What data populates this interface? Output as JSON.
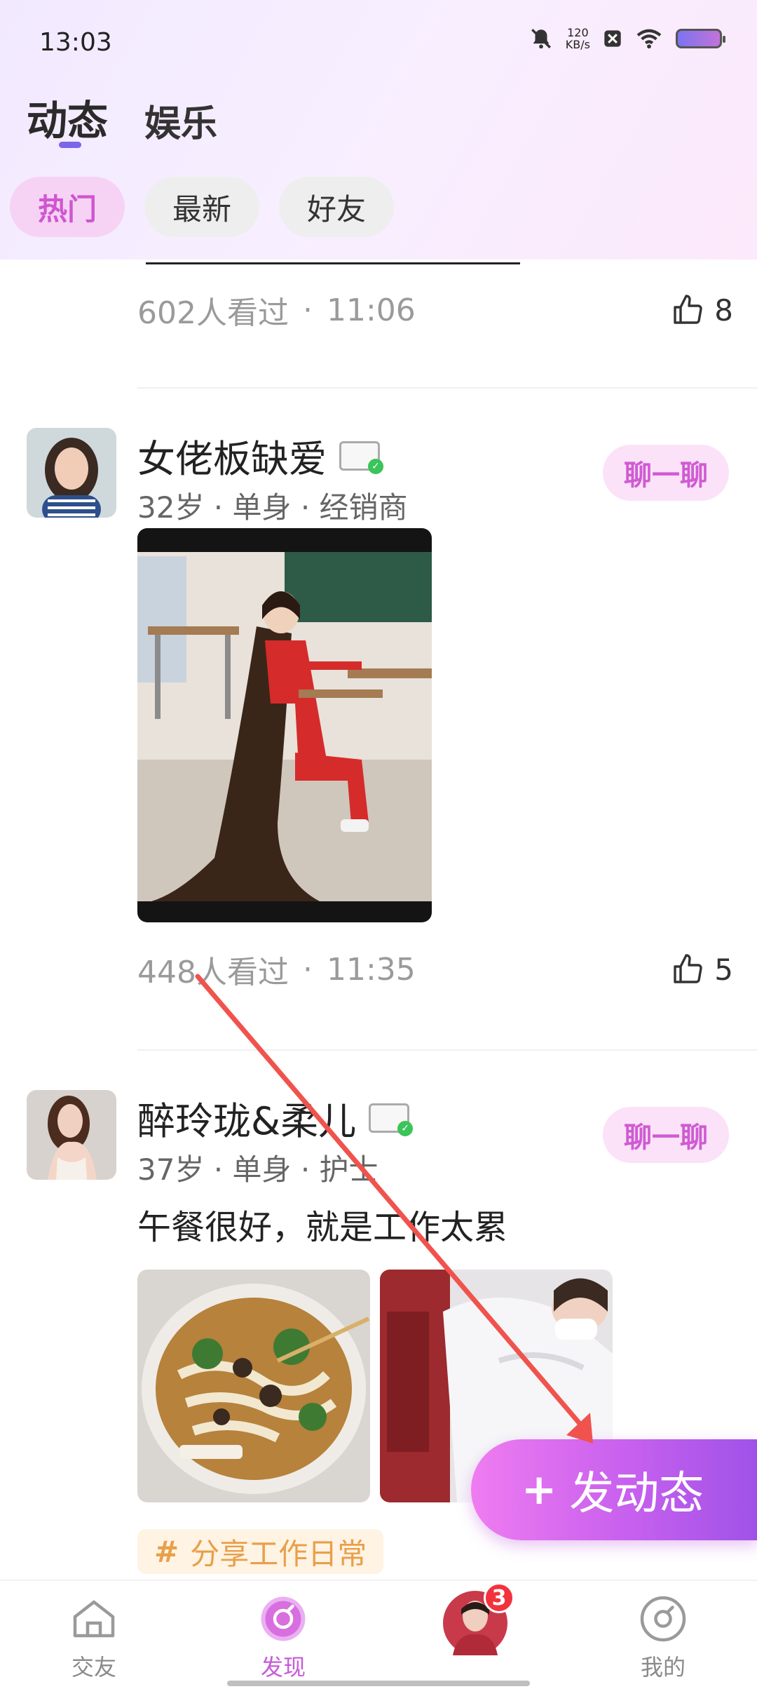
{
  "status_bar": {
    "time": "13:03",
    "net_speed_value": "120",
    "net_speed_unit": "KB/s"
  },
  "main_tabs": [
    {
      "label": "动态",
      "active": true
    },
    {
      "label": "娱乐",
      "active": false
    }
  ],
  "filters": [
    {
      "label": "热门",
      "active": true
    },
    {
      "label": "最新",
      "active": false
    },
    {
      "label": "好友",
      "active": false
    }
  ],
  "partial_post": {
    "views": "602人看过",
    "time": "11:06",
    "likes": "8"
  },
  "posts": [
    {
      "name": "女佬板缺爱",
      "info": "32岁 · 单身 · 经销商",
      "chat_label": "聊一聊",
      "views": "448人看过",
      "time": "11:35",
      "likes": "5"
    },
    {
      "name": "醉玲珑&柔儿",
      "info": "37岁 · 单身 · 护士",
      "chat_label": "聊一聊",
      "caption": "午餐很好，就是工作太累",
      "tag": "分享工作日常"
    }
  ],
  "fab": {
    "label": "发动态"
  },
  "tabbar": [
    {
      "label": "交友",
      "icon": "home-icon"
    },
    {
      "label": "发现",
      "icon": "discover-icon",
      "active": true
    },
    {
      "label": "",
      "icon": "avatar",
      "badge": "3"
    },
    {
      "label": "我的",
      "icon": "profile-icon"
    }
  ],
  "colors": {
    "accent": "#c75bd9",
    "chip_active_bg": "#f6d3f5",
    "tag_text": "#e8a04a",
    "annotation_arrow": "#f0534d"
  }
}
